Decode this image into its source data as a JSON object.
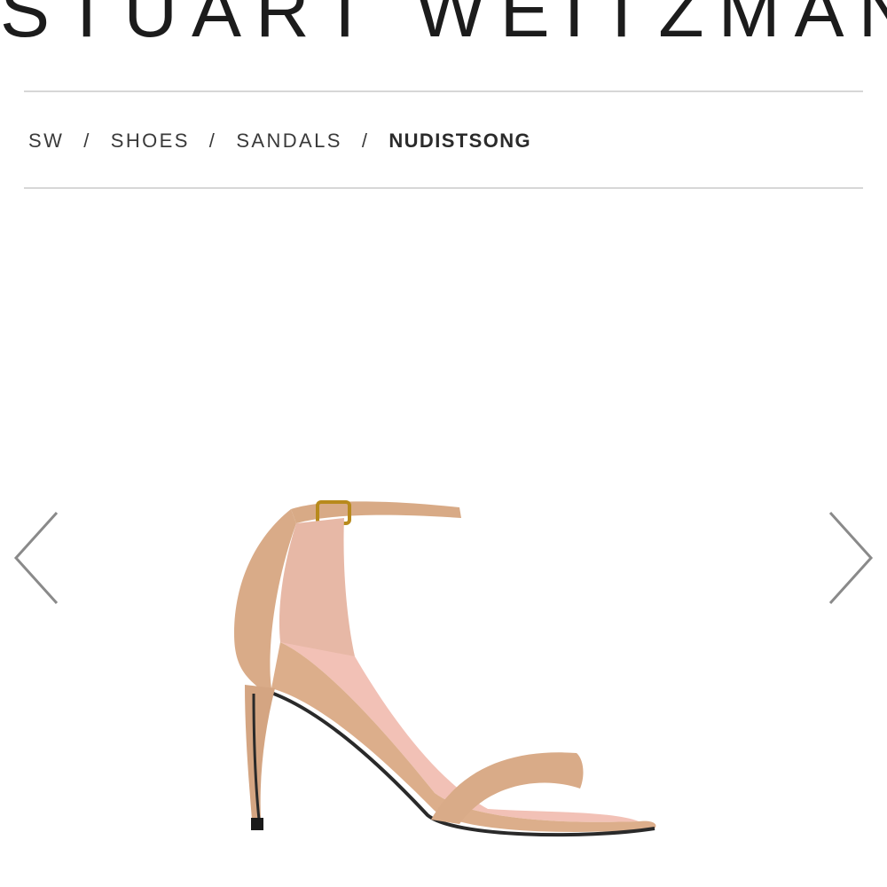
{
  "header": {
    "brand": "STUART WEITZMAN"
  },
  "breadcrumb": {
    "items": [
      "SW",
      "SHOES",
      "SANDALS"
    ],
    "separator": "/",
    "current": "NUDISTSONG"
  },
  "gallery": {
    "prev_icon": "chevron-left-icon",
    "next_icon": "chevron-right-icon",
    "product_image": "nude patent ankle-strap stiletto sandal"
  },
  "colors": {
    "text": "#2a2a2a",
    "rule": "#d7d7d7",
    "arrow": "#8a8a8a",
    "product": "#d9ab88"
  }
}
